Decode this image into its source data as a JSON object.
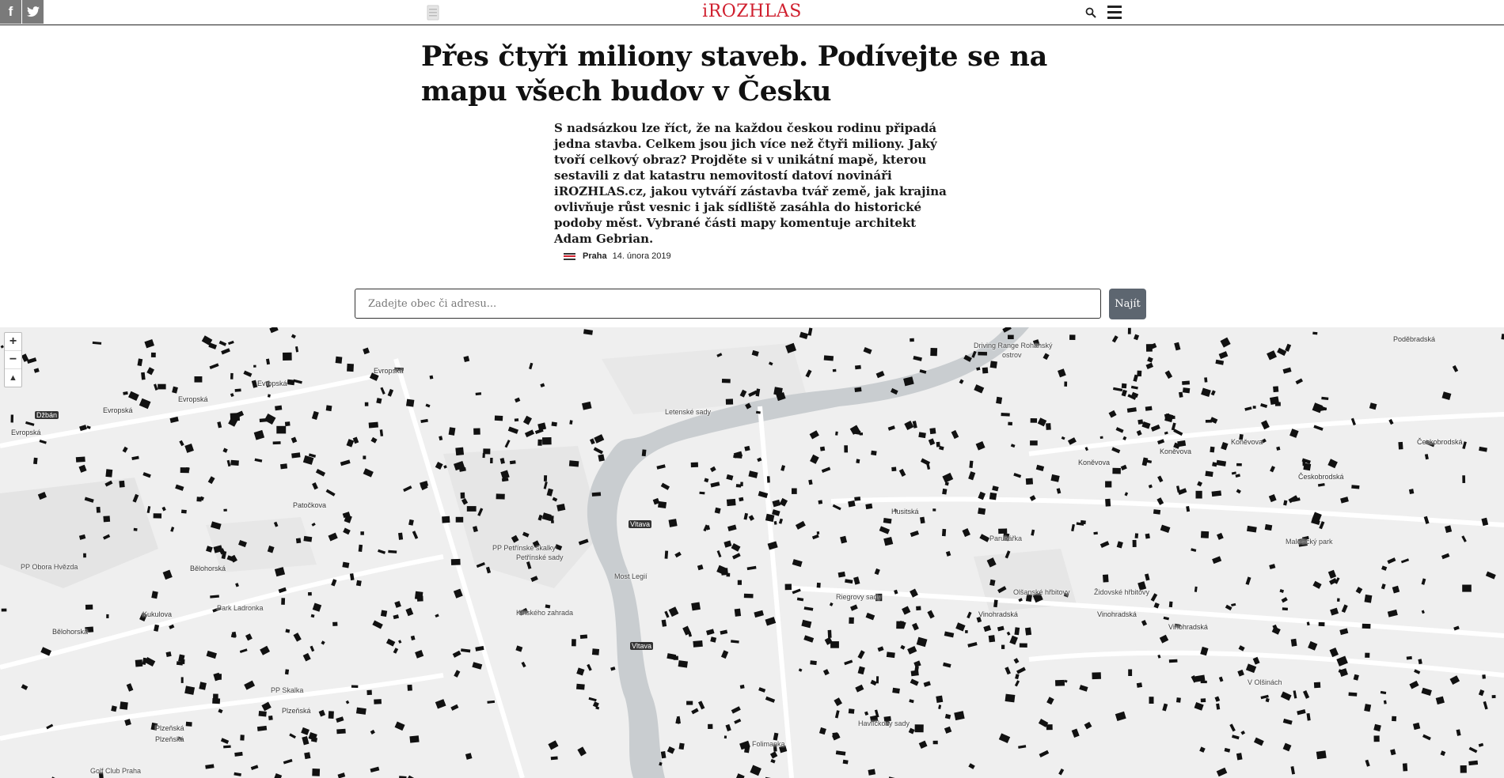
{
  "header": {
    "logo": "iROZHLAS",
    "social": [
      {
        "icon": "facebook-icon",
        "label": "f"
      },
      {
        "icon": "twitter-icon",
        "label": "t"
      }
    ]
  },
  "article": {
    "title": "Přes čtyři miliony staveb. Podívejte se na mapu všech budov v Česku",
    "perex": "S nadsázkou lze říct, že na každou českou rodinu připadá jedna stavba. Celkem jsou jich více než čtyři miliony. Jaký tvoří celkový obraz? Projděte si v unikátní mapě, kterou sestavili z dat katastru nemovitostí datoví novináři iROZHLAS.cz, jakou vytváří zástavba tvář země, jak krajina ovlivňuje růst vesnic i jak sídliště zasáhla do historické podoby měst. Vybrané části mapy komentuje architekt Adam Gebrian.",
    "place": "Praha",
    "date": "14. února 2019"
  },
  "search": {
    "placeholder": "Zadejte obec či adresu...",
    "value": "",
    "button": "Najít"
  },
  "map": {
    "zoom_in": "+",
    "zoom_out": "−",
    "reset": "▲",
    "labels": {
      "dzban": "Džbán",
      "evropska1": "Evropská",
      "evropska2": "Evropská",
      "evropska3": "Evropská",
      "evropska4": "Evropská",
      "evropska5": "Evropská",
      "letenske": "Letenské sady",
      "driving": "Driving Range Rohanský",
      "ostrov": "ostrov",
      "podebradska": "Poděbradská",
      "ceskobrodska": "Českobrodská",
      "konevova1": "Koněvova",
      "konevova2": "Koněvova",
      "konevova3": "Koněvova",
      "husitska": "Husitská",
      "parukarka": "Parukářka",
      "malesicky": "Malešický park",
      "petrin1": "PP Petřínské skalky",
      "petrin2": "Petřínské sady",
      "obora": "PP Obora Hvězda",
      "belohorska1": "Bělohorská",
      "belohorska2": "Bělohorská",
      "kukulova": "Kukulova",
      "ladronka": "Park Ladronka",
      "kinskeho": "Kinského zahrada",
      "vltava1": "Vltava",
      "vltava2": "Vltava",
      "mostlegii": "Most Legií",
      "riegrovy": "Riegrovy sady",
      "olsanske": "Olšanské hřbitovy",
      "zidovske": "Židovské hřbitovy",
      "vinohradska1": "Vinohradská",
      "vinohradska2": "Vinohradská",
      "vinohradska3": "Vinohradská",
      "olsinach": "V Olšinách",
      "skalka": "PP Skalka",
      "plzenska1": "Plzeňská",
      "plzenska2": "Plzeňská",
      "plzenska3": "Plzeňská",
      "golf": "Golf Club Praha",
      "havlickovy": "Havlíčkovy sady",
      "folimanka": "Folimanka",
      "patockova": "Patočkova",
      "ceskobrodska2": "Českobrodská"
    }
  },
  "colors": {
    "brand": "#d01f2e",
    "button": "#5d6670",
    "map_bg": "#efefef",
    "river": "#c9cdd0",
    "buildings": "#111111"
  }
}
